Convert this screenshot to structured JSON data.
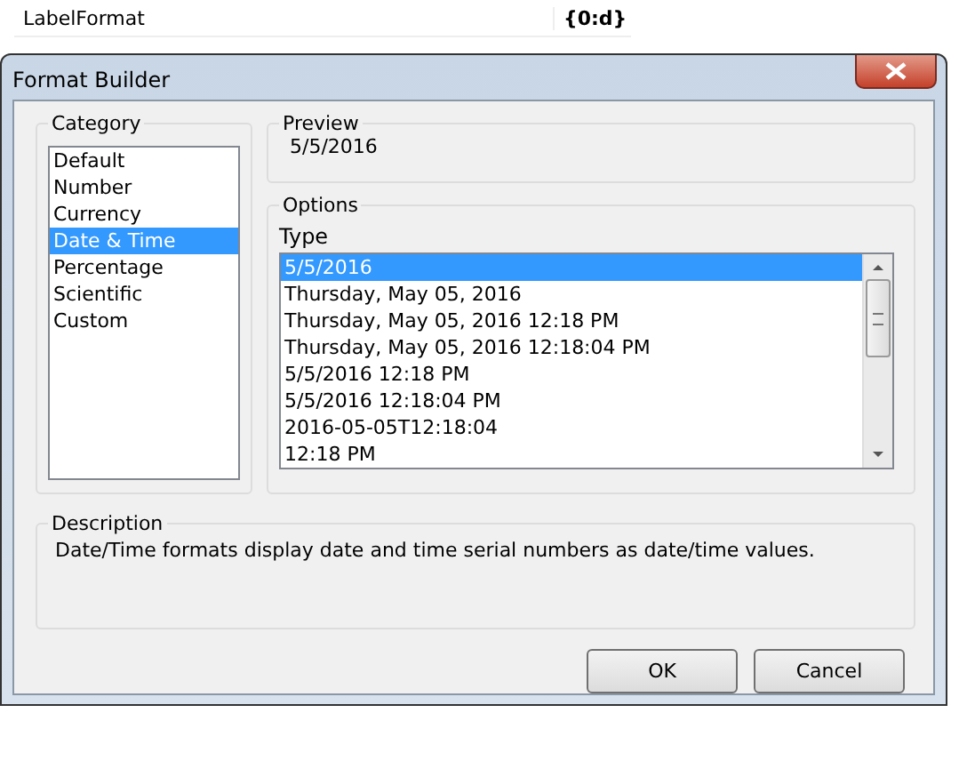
{
  "property_row": {
    "name": "LabelFormat",
    "value": "{0:d}"
  },
  "window": {
    "title": "Format Builder"
  },
  "category": {
    "label": "Category",
    "items": [
      {
        "label": "Default",
        "selected": false
      },
      {
        "label": "Number",
        "selected": false
      },
      {
        "label": "Currency",
        "selected": false
      },
      {
        "label": "Date & Time",
        "selected": true
      },
      {
        "label": "Percentage",
        "selected": false
      },
      {
        "label": "Scientific",
        "selected": false
      },
      {
        "label": "Custom",
        "selected": false
      }
    ]
  },
  "preview": {
    "label": "Preview",
    "value": "5/5/2016"
  },
  "options": {
    "label": "Options",
    "type_label": "Type",
    "types": [
      {
        "label": "5/5/2016",
        "selected": true
      },
      {
        "label": "Thursday, May 05, 2016",
        "selected": false
      },
      {
        "label": "Thursday, May 05, 2016 12:18 PM",
        "selected": false
      },
      {
        "label": "Thursday, May 05, 2016 12:18:04 PM",
        "selected": false
      },
      {
        "label": "5/5/2016 12:18 PM",
        "selected": false
      },
      {
        "label": "5/5/2016 12:18:04 PM",
        "selected": false
      },
      {
        "label": "2016-05-05T12:18:04",
        "selected": false
      },
      {
        "label": "12:18 PM",
        "selected": false
      }
    ]
  },
  "description": {
    "label": "Description",
    "text": "Date/Time formats display date and time serial numbers as date/time values."
  },
  "buttons": [
    "OK",
    "Cancel"
  ]
}
